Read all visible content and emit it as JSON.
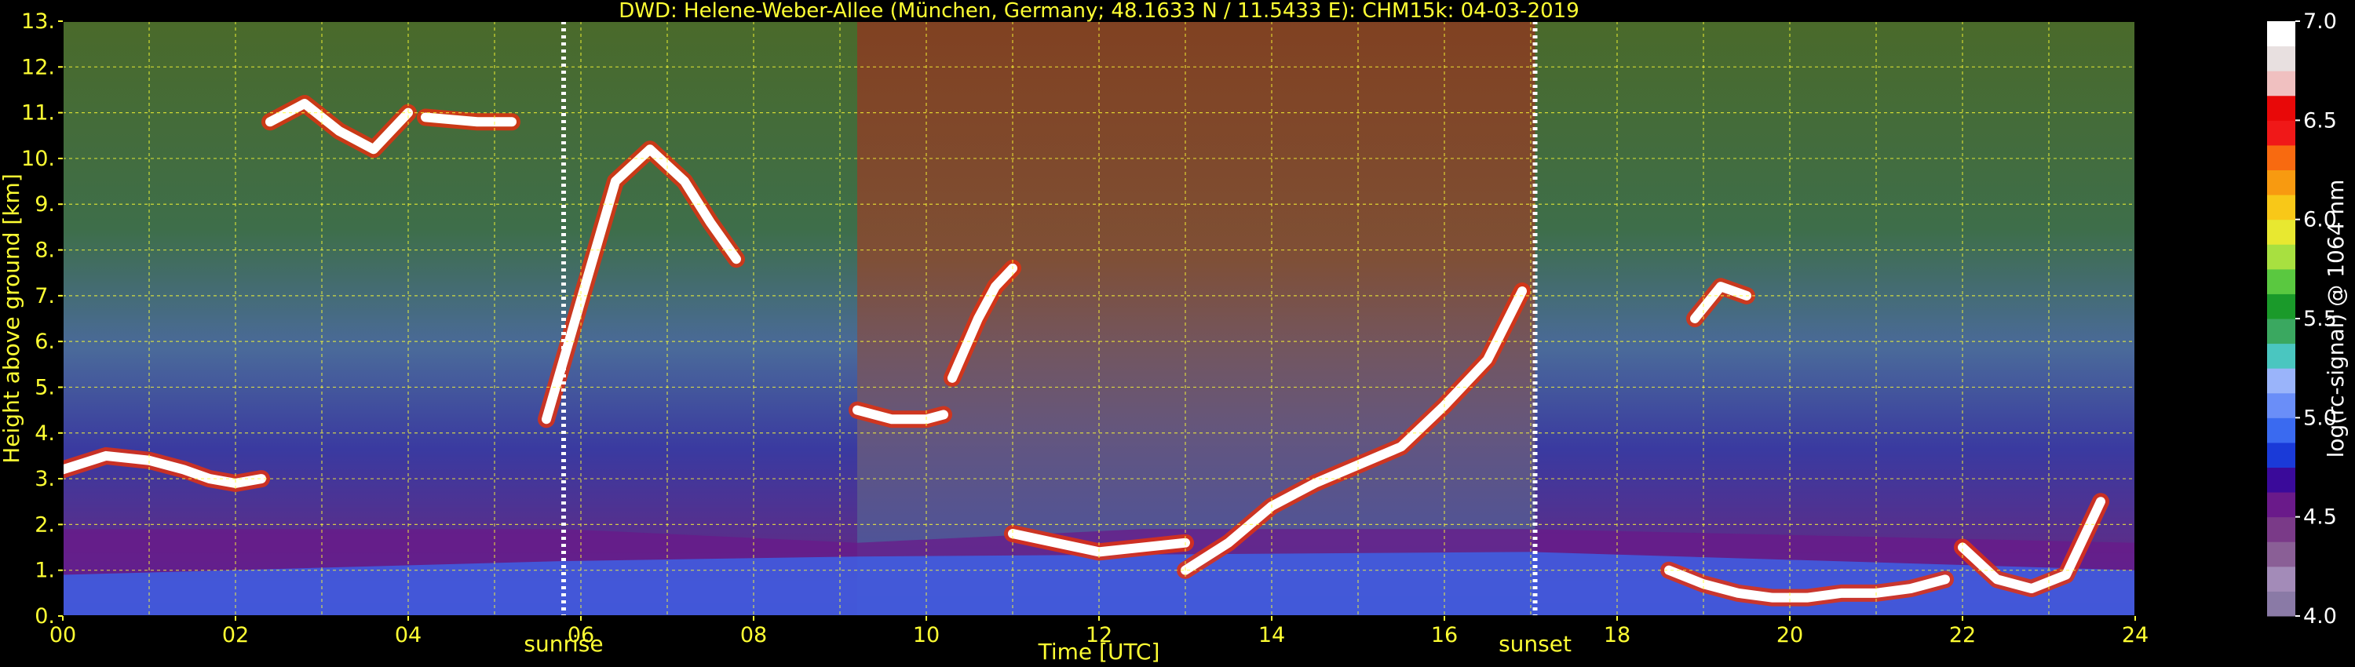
{
  "chart_data": {
    "type": "heatmap",
    "title": "DWD: Helene-Weber-Allee (München, Germany; 48.1633 N / 11.5433 E):    CHM15k: 04-03-2019",
    "xlabel": "Time [UTC]",
    "ylabel": "Height above ground [km]",
    "xlim": [
      0,
      24
    ],
    "ylim": [
      0,
      13
    ],
    "x_ticks": [
      "00",
      "02",
      "04",
      "06",
      "08",
      "10",
      "12",
      "14",
      "16",
      "18",
      "20",
      "22",
      "24"
    ],
    "y_ticks": [
      "0.",
      "1.",
      "2.",
      "3.",
      "4.",
      "5.",
      "6.",
      "7.",
      "8.",
      "9.",
      "10.",
      "11.",
      "12.",
      "13."
    ],
    "grid": true,
    "events": [
      {
        "label": "sunrise",
        "time": 5.8
      },
      {
        "label": "sunset",
        "time": 17.05
      }
    ],
    "colorbar": {
      "label": "log(rc-signal) @ 1064 nm",
      "range": [
        4.0,
        7.0
      ],
      "ticks": [
        "4.0",
        "4.5",
        "5.0",
        "5.5",
        "6.0",
        "6.5",
        "7.0"
      ],
      "colors": [
        "#8a7aa6",
        "#a38bb8",
        "#8a5f96",
        "#7a3a88",
        "#6a1a8a",
        "#3a0a9a",
        "#1a3ad8",
        "#3a6af0",
        "#6a8ef8",
        "#9ab4fa",
        "#4ac6c0",
        "#3aa860",
        "#1a9a2a",
        "#5ac840",
        "#a8e040",
        "#e8e830",
        "#f8c818",
        "#f89a10",
        "#f86a10",
        "#f01818",
        "#e80808",
        "#f0c0c0",
        "#e8e0e0",
        "#ffffff"
      ]
    },
    "layers": [
      {
        "name": "aerosol_layer",
        "x": [
          0,
          5.8,
          9.2,
          12.5,
          17.0,
          24
        ],
        "top": [
          1.9,
          1.9,
          1.6,
          1.9,
          1.9,
          1.6
        ],
        "value": 4.6
      },
      {
        "name": "near_ground",
        "x": [
          0,
          5.8,
          9.2,
          17.0,
          24
        ],
        "top": [
          0.9,
          1.2,
          1.3,
          1.4,
          1.0
        ],
        "value": 4.9
      }
    ],
    "cloud_tracks": [
      {
        "x": [
          0.0,
          0.5,
          1.0,
          1.4,
          1.7,
          2.0,
          2.3
        ],
        "y": [
          3.2,
          3.5,
          3.4,
          3.2,
          3.0,
          2.9,
          3.0
        ]
      },
      {
        "x": [
          2.4,
          2.8,
          3.2,
          3.6,
          4.0
        ],
        "y": [
          10.8,
          11.2,
          10.6,
          10.2,
          11.0
        ]
      },
      {
        "x": [
          4.2,
          4.8,
          5.2
        ],
        "y": [
          10.9,
          10.8,
          10.8
        ]
      },
      {
        "x": [
          5.6,
          6.4,
          6.8,
          7.2,
          7.5,
          7.8
        ],
        "y": [
          4.3,
          9.5,
          10.2,
          9.5,
          8.6,
          7.8
        ]
      },
      {
        "x": [
          9.2,
          9.6,
          10.0,
          10.2
        ],
        "y": [
          4.5,
          4.3,
          4.3,
          4.4
        ]
      },
      {
        "x": [
          10.3,
          10.6,
          10.8,
          11.0
        ],
        "y": [
          5.2,
          6.5,
          7.2,
          7.6
        ]
      },
      {
        "x": [
          11.0,
          11.5,
          12.0,
          12.5,
          13.0
        ],
        "y": [
          1.8,
          1.6,
          1.4,
          1.5,
          1.6
        ]
      },
      {
        "x": [
          13.0,
          13.5,
          14.0,
          14.5,
          15.0,
          15.5,
          16.0,
          16.5,
          16.9
        ],
        "y": [
          1.0,
          1.6,
          2.4,
          2.9,
          3.3,
          3.7,
          4.6,
          5.6,
          7.1
        ]
      },
      {
        "x": [
          18.6,
          19.0,
          19.4,
          19.8,
          20.2,
          20.6,
          21.0,
          21.4,
          21.8
        ],
        "y": [
          1.0,
          0.7,
          0.5,
          0.4,
          0.4,
          0.5,
          0.5,
          0.6,
          0.8
        ]
      },
      {
        "x": [
          22.0,
          22.4,
          22.8,
          23.2,
          23.6
        ],
        "y": [
          1.5,
          0.8,
          0.6,
          0.9,
          2.5
        ]
      },
      {
        "x": [
          18.9,
          19.2,
          19.5
        ],
        "y": [
          6.5,
          7.2,
          7.0
        ]
      }
    ]
  }
}
